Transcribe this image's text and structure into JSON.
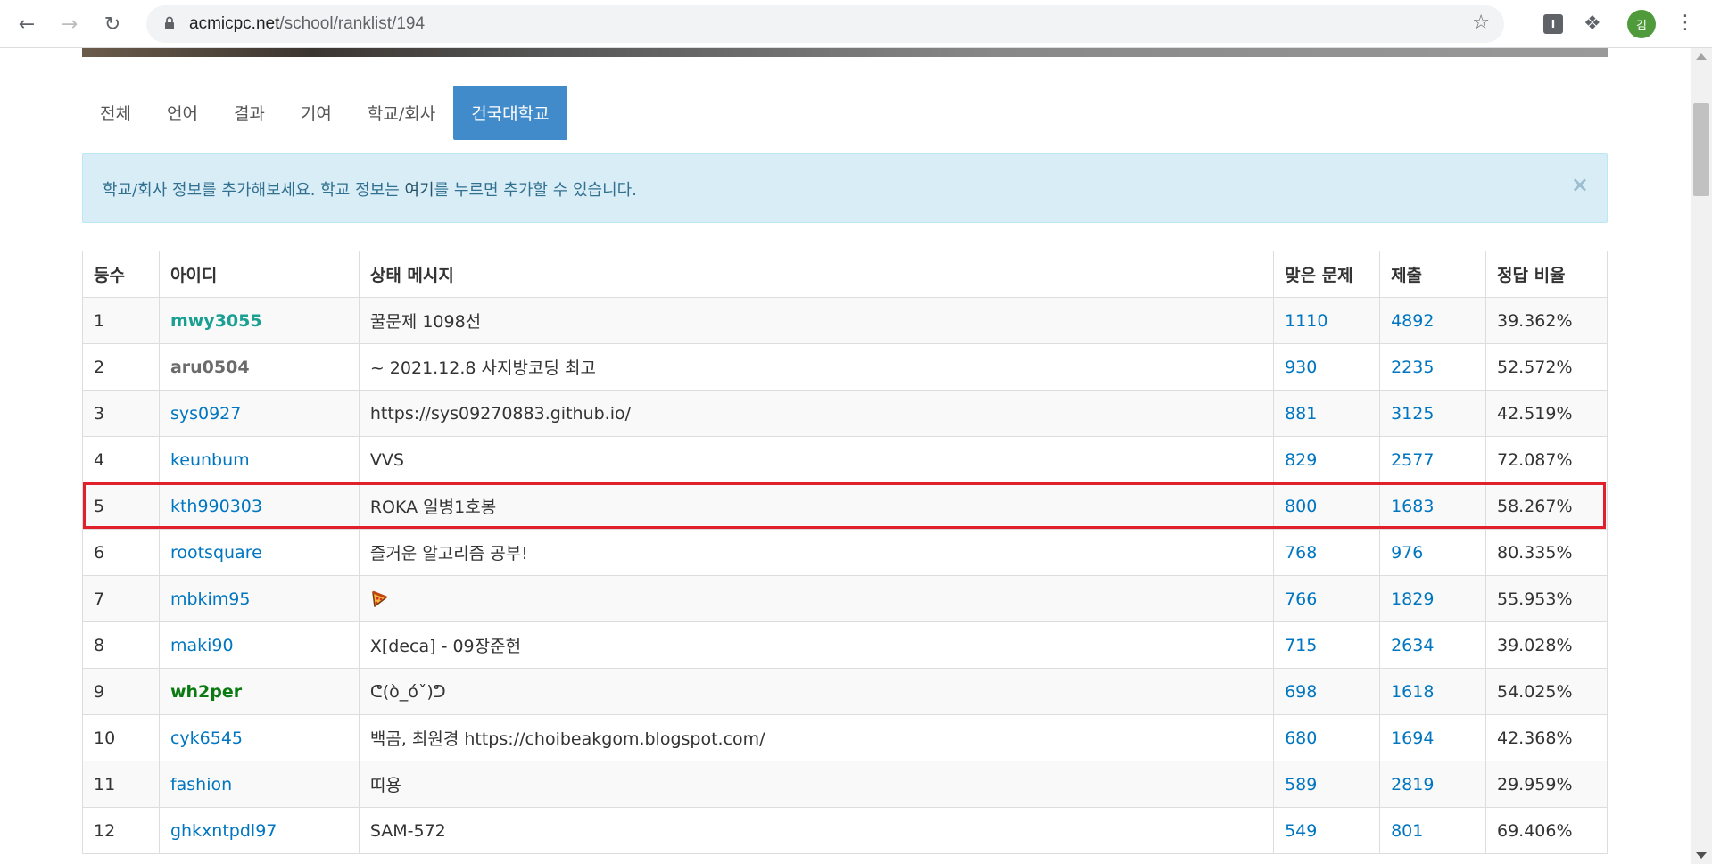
{
  "browser": {
    "url_domain": "acmicpc.net",
    "url_path": "/school/ranklist/194",
    "profile_initial": "김",
    "extension_label": "I"
  },
  "tabs": [
    {
      "label": "전체",
      "active": false
    },
    {
      "label": "언어",
      "active": false
    },
    {
      "label": "결과",
      "active": false
    },
    {
      "label": "기여",
      "active": false
    },
    {
      "label": "학교/회사",
      "active": false
    },
    {
      "label": "건국대학교",
      "active": true
    }
  ],
  "alert": {
    "text_before": "학교/회사 정보를 추가해보세요. 학교 정보는 ",
    "link_text": "여기",
    "text_after": "를 누르면 추가할 수 있습니다.",
    "close": "×"
  },
  "table": {
    "headers": [
      "등수",
      "아이디",
      "상태 메시지",
      "맞은 문제",
      "제출",
      "정답 비율"
    ],
    "rows": [
      {
        "rank": "1",
        "id": "mwy3055",
        "id_style": "teal",
        "message": "꿀문제 1098선",
        "solved": "1110",
        "submissions": "4892",
        "ratio": "39.362%"
      },
      {
        "rank": "2",
        "id": "aru0504",
        "id_style": "gray",
        "message": "~ 2021.12.8 사지방코딩 최고",
        "solved": "930",
        "submissions": "2235",
        "ratio": "52.572%"
      },
      {
        "rank": "3",
        "id": "sys0927",
        "id_style": "blue",
        "message": "https://sys09270883.github.io/",
        "solved": "881",
        "submissions": "3125",
        "ratio": "42.519%"
      },
      {
        "rank": "4",
        "id": "keunbum",
        "id_style": "blue",
        "message": "VVS",
        "solved": "829",
        "submissions": "2577",
        "ratio": "72.087%"
      },
      {
        "rank": "5",
        "id": "kth990303",
        "id_style": "blue",
        "message": "ROKA 일병1호봉",
        "solved": "800",
        "submissions": "1683",
        "ratio": "58.267%"
      },
      {
        "rank": "6",
        "id": "rootsquare",
        "id_style": "blue",
        "message": "즐거운 알고리즘 공부!",
        "solved": "768",
        "submissions": "976",
        "ratio": "80.335%"
      },
      {
        "rank": "7",
        "id": "mbkim95",
        "id_style": "blue",
        "message": "",
        "message_icon": "pizza-icon",
        "solved": "766",
        "submissions": "1829",
        "ratio": "55.953%"
      },
      {
        "rank": "8",
        "id": "maki90",
        "id_style": "blue",
        "message": "X[deca] - 09장준현",
        "solved": "715",
        "submissions": "2634",
        "ratio": "39.028%"
      },
      {
        "rank": "9",
        "id": "wh2per",
        "id_style": "green",
        "message": "ᕦ(ò_óˇ)ᕤ",
        "solved": "698",
        "submissions": "1618",
        "ratio": "54.025%"
      },
      {
        "rank": "10",
        "id": "cyk6545",
        "id_style": "blue",
        "message": "백곰, 최원경 https://choibeakgom.blogspot.com/",
        "solved": "680",
        "submissions": "1694",
        "ratio": "42.368%"
      },
      {
        "rank": "11",
        "id": "fashion",
        "id_style": "blue",
        "message": "띠용",
        "solved": "589",
        "submissions": "2819",
        "ratio": "29.959%"
      },
      {
        "rank": "12",
        "id": "ghkxntpdl97",
        "id_style": "blue",
        "message": "SAM-572",
        "solved": "549",
        "submissions": "801",
        "ratio": "69.406%"
      }
    ]
  },
  "colors": {
    "tab_active": "#428bca",
    "link": "#0076c0",
    "alert_bg": "#d9edf7",
    "alert_text": "#31708f",
    "highlight_border": "#e0202a",
    "id_teal": "#1aa092",
    "id_green": "#0a7b10"
  }
}
